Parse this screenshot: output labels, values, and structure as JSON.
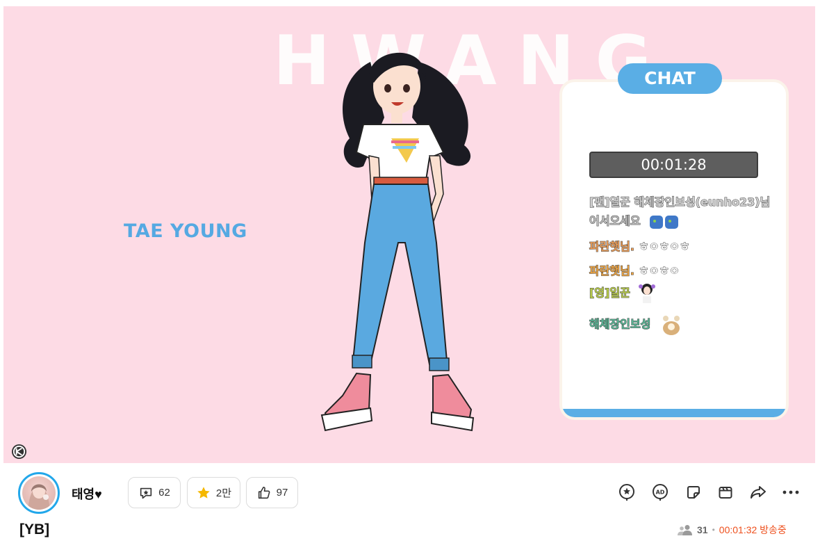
{
  "stream_overlay": {
    "banner_text": "HWANG",
    "name_text": "TAE YOUNG",
    "chat_header": "CHAT",
    "chat_timer": "00:01:28",
    "chat_messages": [
      {
        "name": "[팬]열꾼 해체장인보성(eunho23)님",
        "text": "",
        "color": "#cfcfcf"
      },
      {
        "name": "어서오세요",
        "text": "",
        "color": "#bdbdbd"
      },
      {
        "name": "파란햇님.",
        "text": "ㅎㅇㅎㅇㅎ",
        "color": "#e79a56"
      },
      {
        "name": "파란햇님.",
        "text": "ㅎㅇㅎㅇ",
        "color": "#e8a142"
      },
      {
        "name": "[영]일꾼",
        "text": "",
        "color": "#b6c94a"
      },
      {
        "name": "해체장인보성",
        "text": "",
        "color": "#58b393"
      }
    ]
  },
  "channel": {
    "streamer_name": "태영♥",
    "stats": {
      "fan_count": "62",
      "star_count": "2만",
      "like_count": "97"
    },
    "stream_title": "[YB]",
    "viewer_count": "31",
    "separator": "•",
    "live_status": "00:01:32 방송중"
  },
  "icons": [
    "watermark-logo-icon",
    "fan-badge-icon",
    "star-icon",
    "thumbs-up-icon",
    "star-balloon-icon",
    "ad-balloon-icon",
    "sticker-icon",
    "clip-icon",
    "share-icon",
    "more-icon",
    "viewers-icon"
  ],
  "colors": {
    "accent_blue": "#5aaee5",
    "live_red": "#ee4f1c",
    "stage_pink": "#fddbe5",
    "star_yellow": "#f5b800"
  }
}
